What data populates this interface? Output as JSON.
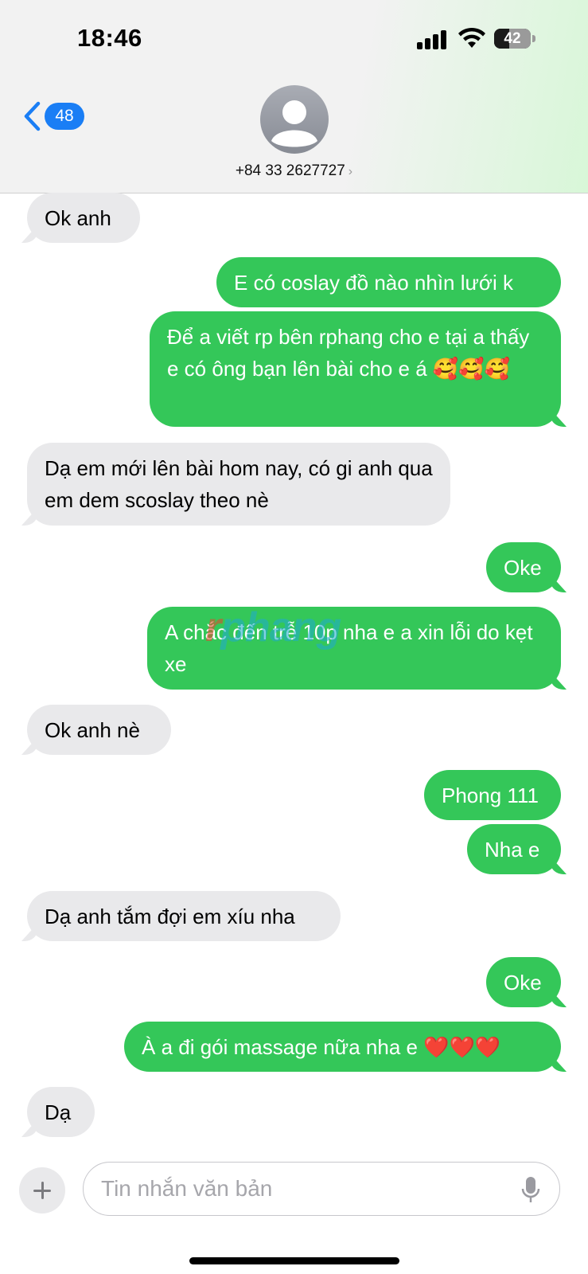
{
  "status_bar": {
    "time": "18:46",
    "battery": "42",
    "battery_level": 0.42
  },
  "header": {
    "back_badge": "48",
    "contact": "+84 33 2627727",
    "chevron": "›"
  },
  "watermark": {
    "prefix": "r",
    "rest": "phang"
  },
  "messages": [
    {
      "side": "recv",
      "text": "Ok anh"
    },
    {
      "side": "sent",
      "text": "E có coslay đồ nào nhìn lưới k"
    },
    {
      "side": "sent",
      "text": "Để a viết rp bên rphang cho e tại a thấy e có ông bạn lên bài cho e á 🥰🥰🥰"
    },
    {
      "side": "recv",
      "text": "Dạ em mới lên bài hom nay, có gi anh qua em dem scoslay theo nè"
    },
    {
      "side": "sent",
      "text": "Oke"
    },
    {
      "side": "sent",
      "text": "A chắc đến trễ 10p nha e a xin lỗi do kẹt xe"
    },
    {
      "side": "recv",
      "text": "Ok anh nè"
    },
    {
      "side": "sent",
      "text": "Phong 111"
    },
    {
      "side": "sent",
      "text": "Nha e"
    },
    {
      "side": "recv",
      "text": "Dạ anh tắm đợi em xíu nha"
    },
    {
      "side": "sent",
      "text": "Oke"
    },
    {
      "side": "sent",
      "text": "À a đi gói massage nữa nha e ❤️❤️❤️"
    },
    {
      "side": "recv",
      "text": "Dạ"
    }
  ],
  "composer": {
    "placeholder": "Tin nhắn văn bản"
  },
  "icons": [
    "back-chevron-icon",
    "contact-avatar-icon",
    "plus-icon",
    "microphone-icon",
    "signal-icon",
    "wifi-icon",
    "battery-icon"
  ]
}
